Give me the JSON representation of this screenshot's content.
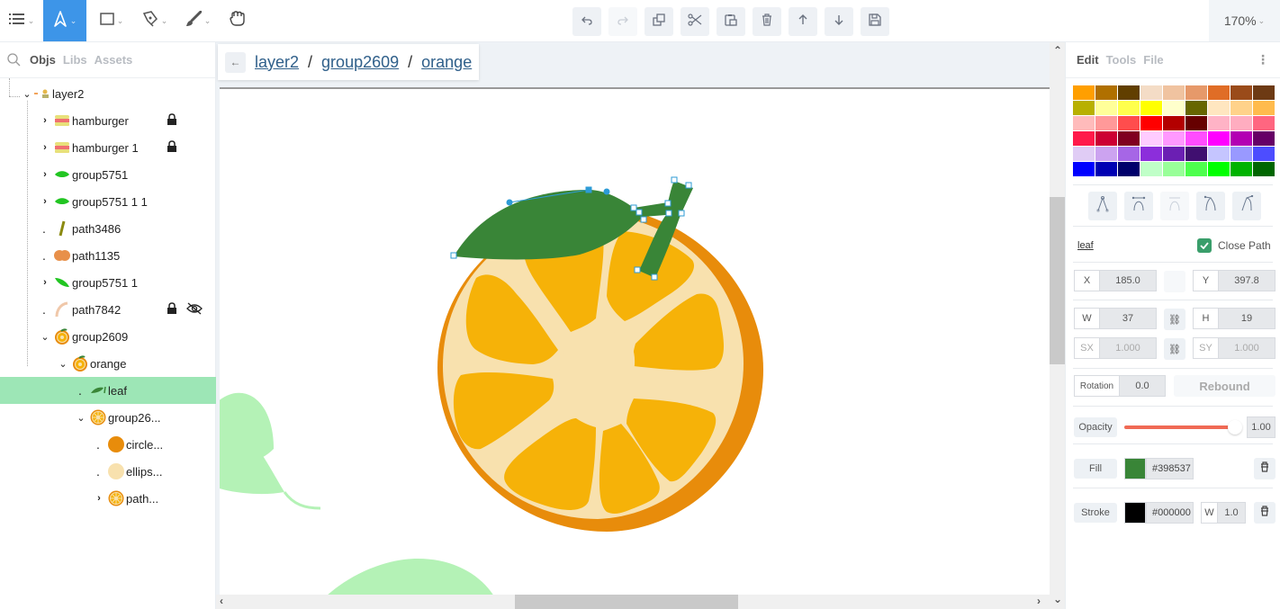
{
  "toolbar": {
    "tools": [
      {
        "name": "menu",
        "icon": "menu-icon",
        "active": false
      },
      {
        "name": "select",
        "icon": "select-arrow-icon",
        "active": true
      },
      {
        "name": "rectangle",
        "icon": "rectangle-icon",
        "active": false
      },
      {
        "name": "pen",
        "icon": "pen-icon",
        "active": false
      },
      {
        "name": "brush",
        "icon": "brush-icon",
        "active": false
      },
      {
        "name": "hand",
        "icon": "hand-icon",
        "active": false
      }
    ],
    "actions": [
      {
        "name": "undo",
        "icon": "undo-icon",
        "enabled": true
      },
      {
        "name": "redo",
        "icon": "redo-icon",
        "enabled": false
      },
      {
        "name": "duplicate",
        "icon": "duplicate-icon",
        "enabled": true
      },
      {
        "name": "cut",
        "icon": "scissors-icon",
        "enabled": true
      },
      {
        "name": "paste",
        "icon": "paste-icon",
        "enabled": true
      },
      {
        "name": "delete",
        "icon": "trash-icon",
        "enabled": true
      },
      {
        "name": "move-up",
        "icon": "arrow-up-icon",
        "enabled": true
      },
      {
        "name": "move-down",
        "icon": "arrow-down-icon",
        "enabled": true
      },
      {
        "name": "save",
        "icon": "save-icon",
        "enabled": true
      }
    ],
    "zoom_level": "170%"
  },
  "left_panel": {
    "tabs": [
      {
        "label": "Objs",
        "active": true
      },
      {
        "label": "Libs",
        "active": false
      },
      {
        "label": "Assets",
        "active": false
      }
    ],
    "tree": [
      {
        "label": "layer2",
        "depth": 0,
        "toggle": "expanded",
        "thumb": "layer",
        "locked": false,
        "hidden": false,
        "selected": false
      },
      {
        "label": "hamburger",
        "depth": 1,
        "toggle": "collapsed",
        "thumb": "hamburger",
        "locked": true,
        "hidden": false,
        "selected": false
      },
      {
        "label": "hamburger 1",
        "depth": 1,
        "toggle": "collapsed",
        "thumb": "hamburger",
        "locked": true,
        "hidden": false,
        "selected": false
      },
      {
        "label": "group5751",
        "depth": 1,
        "toggle": "collapsed",
        "thumb": "leaf-green",
        "locked": false,
        "hidden": false,
        "selected": false
      },
      {
        "label": "group5751 1 1",
        "depth": 1,
        "toggle": "collapsed",
        "thumb": "leaf-green",
        "locked": false,
        "hidden": false,
        "selected": false
      },
      {
        "label": "path3486",
        "depth": 1,
        "toggle": "leaf",
        "thumb": "stick",
        "locked": false,
        "hidden": false,
        "selected": false
      },
      {
        "label": "path1135",
        "depth": 1,
        "toggle": "leaf",
        "thumb": "peach",
        "locked": false,
        "hidden": false,
        "selected": false
      },
      {
        "label": "group5751 1",
        "depth": 1,
        "toggle": "collapsed",
        "thumb": "leaf-green2",
        "locked": false,
        "hidden": false,
        "selected": false
      },
      {
        "label": "path7842",
        "depth": 1,
        "toggle": "leaf",
        "thumb": "arc",
        "locked": true,
        "hidden": true,
        "selected": false
      },
      {
        "label": "group2609",
        "depth": 1,
        "toggle": "expanded",
        "thumb": "orange",
        "locked": false,
        "hidden": false,
        "selected": false
      },
      {
        "label": "orange",
        "depth": 2,
        "toggle": "expanded",
        "thumb": "orange",
        "locked": false,
        "hidden": false,
        "selected": false
      },
      {
        "label": "leaf",
        "depth": 3,
        "toggle": "leaf",
        "thumb": "dark-leaf",
        "locked": false,
        "hidden": false,
        "selected": true
      },
      {
        "label": "group26...",
        "depth": 3,
        "toggle": "expanded",
        "thumb": "orange-slice",
        "locked": false,
        "hidden": false,
        "selected": false
      },
      {
        "label": "circle...",
        "depth": 4,
        "toggle": "leaf",
        "thumb": "orange-circle",
        "locked": false,
        "hidden": false,
        "selected": false
      },
      {
        "label": "ellips...",
        "depth": 4,
        "toggle": "leaf",
        "thumb": "cream-circle",
        "locked": false,
        "hidden": false,
        "selected": false
      },
      {
        "label": "path...",
        "depth": 4,
        "toggle": "collapsed",
        "thumb": "orange-slice",
        "locked": false,
        "hidden": false,
        "selected": false
      }
    ]
  },
  "breadcrumb": {
    "items": [
      "layer2",
      "group2609",
      "orange"
    ],
    "separator": "/"
  },
  "right_panel": {
    "tabs": [
      {
        "label": "Edit",
        "active": true
      },
      {
        "label": "Tools",
        "active": false
      },
      {
        "label": "File",
        "active": false
      }
    ],
    "palette": [
      "#ff9f00",
      "#b07000",
      "#613f00",
      "#f4dcc6",
      "#f0c3a0",
      "#e6996a",
      "#e06d26",
      "#9a4b1a",
      "#6d3a14",
      "#b8b000",
      "#ffff99",
      "#ffff4d",
      "#ffff00",
      "#ffffcc",
      "#666600",
      "#ffe6c0",
      "#ffd28a",
      "#ffbb4d",
      "#ffbbbb",
      "#ff9999",
      "#ff4d4d",
      "#ff0000",
      "#b30000",
      "#660000",
      "#ffb3c6",
      "#ffadc0",
      "#ff6680",
      "#ff1a4a",
      "#cc0033",
      "#800020",
      "#ffccff",
      "#ff99ff",
      "#ff4dff",
      "#ff00ff",
      "#b300b3",
      "#660066",
      "#e0ccf5",
      "#cca3f0",
      "#a666e6",
      "#8c2edb",
      "#6b1fb3",
      "#400f70",
      "#c5c5ff",
      "#9999ff",
      "#4d4dff",
      "#0000ff",
      "#0000b3",
      "#00006b",
      "#c0ffc8",
      "#99ff99",
      "#4dff4d",
      "#00ff00",
      "#00b300",
      "#006600"
    ],
    "node_tools": [
      "corner-node-icon",
      "smooth-node-icon",
      "symmetric-node-icon",
      "smooth-left-node-icon",
      "smooth-right-node-icon"
    ],
    "node_tools_enabled": [
      true,
      true,
      false,
      true,
      true
    ],
    "element_name": "leaf",
    "close_path": {
      "label": "Close Path",
      "checked": true
    },
    "x": {
      "label": "X",
      "value": "185.0"
    },
    "y": {
      "label": "Y",
      "value": "397.8"
    },
    "w": {
      "label": "W",
      "value": "37"
    },
    "h": {
      "label": "H",
      "value": "19"
    },
    "sx": {
      "label": "SX",
      "value": "1.000"
    },
    "sy": {
      "label": "SY",
      "value": "1.000"
    },
    "rotation": {
      "label": "Rotation",
      "value": "0.0"
    },
    "rebound_label": "Rebound",
    "opacity": {
      "label": "Opacity",
      "value": "1.00",
      "fraction": 1.0,
      "color": "#f06a55"
    },
    "fill": {
      "label": "Fill",
      "color": "#398537",
      "value": "#398537"
    },
    "stroke": {
      "label": "Stroke",
      "color": "#000000",
      "value": "#000000",
      "width_label": "W",
      "width": "1.0"
    }
  },
  "canvas": {
    "colors": {
      "leaf": "#398537",
      "peel": "#e88c0b",
      "pith": "#f8e1ae",
      "segment": "#f6b208",
      "bg_leaf": "#b4f2b6",
      "selection": "#2d9bd6"
    }
  }
}
